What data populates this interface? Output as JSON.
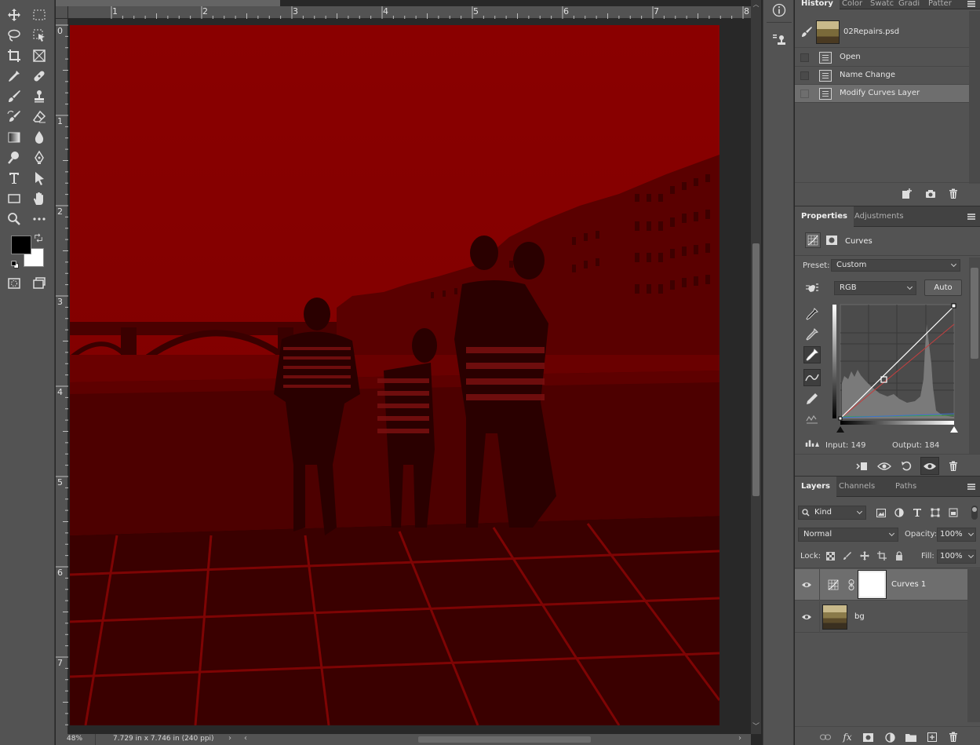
{
  "toolbar": {
    "tools": [
      "move-tool",
      "marquee-tool",
      "lasso-tool",
      "object-select-tool",
      "crop-tool",
      "frame-tool",
      "eyedropper-tool",
      "healing-brush-tool",
      "brush-tool",
      "clone-stamp-tool",
      "history-brush-tool",
      "eraser-tool",
      "gradient-tool",
      "blur-tool",
      "dodge-tool",
      "pen-tool",
      "type-tool",
      "path-select-tool",
      "rectangle-tool",
      "hand-tool",
      "zoom-tool",
      "more-tools"
    ],
    "foreground_color": "#000000",
    "background_color": "#ffffff"
  },
  "rulers": {
    "top": [
      "1",
      "2",
      "3",
      "4",
      "5",
      "6",
      "7",
      "8"
    ],
    "left": [
      "0",
      "1",
      "2",
      "3",
      "4",
      "5",
      "6",
      "7"
    ]
  },
  "document": {
    "tint_color": "#8e0000"
  },
  "status": {
    "zoom": "48%",
    "doc_size": "7.729 in x 7.746 in (240 ppi)"
  },
  "history": {
    "tabs": [
      "History",
      "Color",
      "Swatc",
      "Gradi",
      "Patter"
    ],
    "snapshot_name": "02Repairs.psd",
    "items": [
      {
        "label": "Open"
      },
      {
        "label": "Name Change"
      },
      {
        "label": "Modify Curves Layer"
      }
    ]
  },
  "properties": {
    "tabs": [
      "Properties",
      "Adjustments"
    ],
    "adjustment_name": "Curves",
    "preset_label": "Preset:",
    "preset_value": "Custom",
    "channel_value": "RGB",
    "auto_label": "Auto",
    "input_label": "Input: 149",
    "output_label": "Output: 184"
  },
  "layers": {
    "tabs": [
      "Layers",
      "Channels",
      "Paths"
    ],
    "filter_kind": "Kind",
    "blend_mode": "Normal",
    "opacity_label": "Opacity:",
    "opacity_value": "100%",
    "lock_label": "Lock:",
    "fill_label": "Fill:",
    "fill_value": "100%",
    "items": [
      {
        "name": "Curves 1"
      },
      {
        "name": "bg"
      }
    ]
  }
}
